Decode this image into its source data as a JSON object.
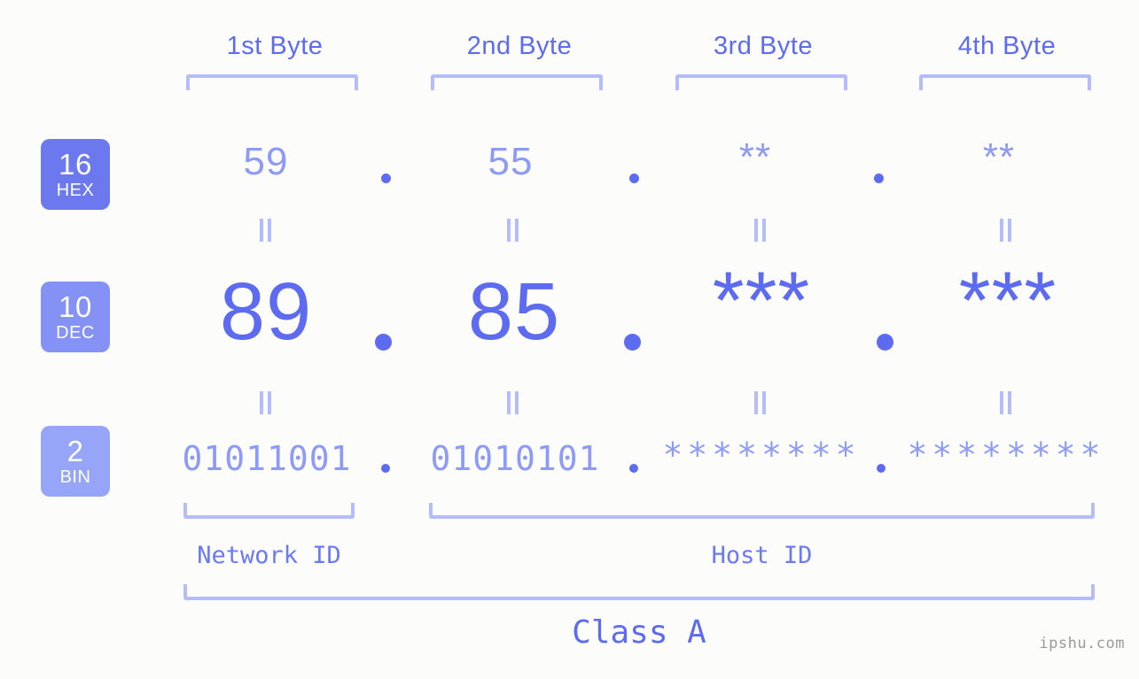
{
  "meta": {
    "background_color": "#fcfdfa",
    "accent_color": "#5c6bf0",
    "accent_light_color": "#8d9af6",
    "bracket_color": "#b4bcfb",
    "watermark": "ipshu.com"
  },
  "byte_headers": [
    {
      "label": "1st Byte"
    },
    {
      "label": "2nd Byte"
    },
    {
      "label": "3rd Byte"
    },
    {
      "label": "4th Byte"
    }
  ],
  "bases": [
    {
      "number": "16",
      "name": "HEX",
      "color": "#6b78ee"
    },
    {
      "number": "10",
      "name": "DEC",
      "color": "#8491f5"
    },
    {
      "number": "2",
      "name": "BIN",
      "color": "#96a5f8"
    }
  ],
  "rows": {
    "hex": {
      "values": [
        "59",
        "55",
        "**",
        "**"
      ]
    },
    "dec": {
      "values": [
        "89",
        "85",
        "***",
        "***"
      ]
    },
    "bin": {
      "values": [
        "01011001",
        "01010101",
        "********",
        "********"
      ]
    }
  },
  "separators": {
    "dot": ".",
    "equals": "="
  },
  "id_labels": [
    {
      "label": "Network ID"
    },
    {
      "label": "Host ID"
    }
  ],
  "class_label": "Class A"
}
